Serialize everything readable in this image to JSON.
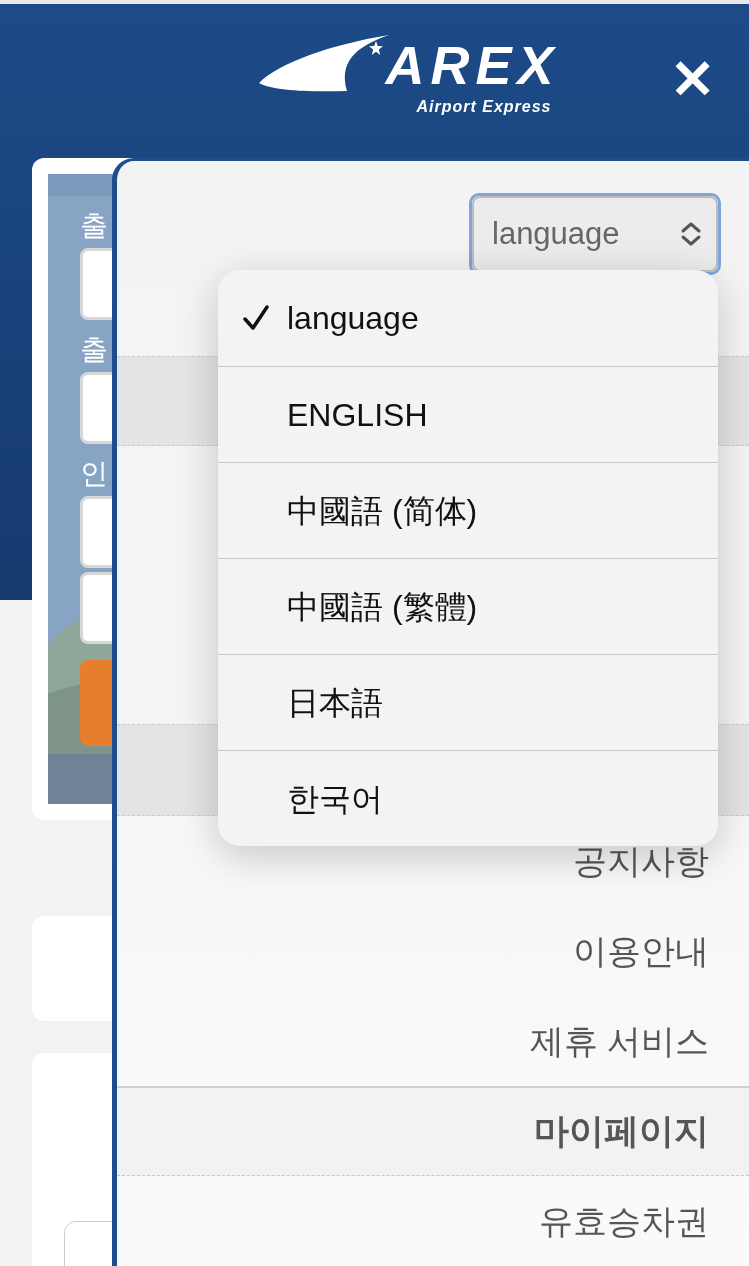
{
  "header": {
    "logo_text": "AREX",
    "logo_tagline": "Airport Express",
    "close_label": "✕"
  },
  "background_form": {
    "fields": [
      {
        "label": "출"
      },
      {
        "label": "출"
      },
      {
        "label": "인"
      }
    ]
  },
  "drawer": {
    "language_select": {
      "value": "language",
      "options": [
        {
          "label": "language",
          "selected": true
        },
        {
          "label": "ENGLISH",
          "selected": false
        },
        {
          "label": "中國語 (简体)",
          "selected": false
        },
        {
          "label": "中國語 (繁體)",
          "selected": false
        },
        {
          "label": "日本語",
          "selected": false
        },
        {
          "label": "한국어",
          "selected": false
        }
      ]
    },
    "menu": [
      {
        "kind": "item",
        "label": "공지사항"
      },
      {
        "kind": "item",
        "label": "이용안내"
      },
      {
        "kind": "item",
        "label": "제휴 서비스"
      },
      {
        "kind": "section",
        "label": "마이페이지"
      },
      {
        "kind": "item",
        "label": "유효승차권"
      }
    ]
  }
}
